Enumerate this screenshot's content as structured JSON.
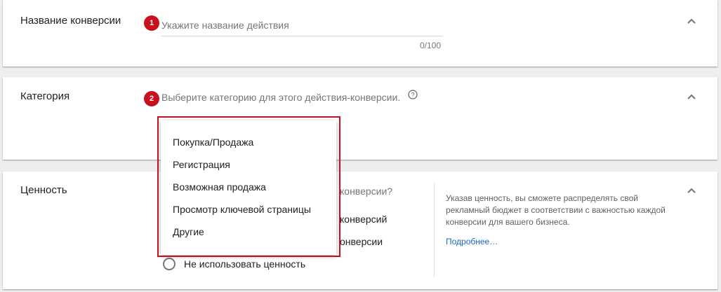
{
  "steps": {
    "one": "1",
    "two": "2"
  },
  "conversion_name": {
    "title": "Название конверсии",
    "placeholder": "Укажите название действия",
    "value": "",
    "counter": "0/100"
  },
  "category": {
    "title": "Категория",
    "placeholder": "Выберите категорию для этого действия-конверсии.",
    "options": [
      "Покупка/Продажа",
      "Регистрация",
      "Возможная продажа",
      "Просмотр ключевой страницы",
      "Другие"
    ]
  },
  "value": {
    "title": "Ценность",
    "question_tail": "конверсии?",
    "option1_tail": "конверсий",
    "option2_tail": "онверсии",
    "no_value_label": "Не использовать ценность",
    "info_text": "Указав ценность, вы сможете распределять свой рекламный бюджет в соответствии с важностью каждой конверсии для вашего бизнеса.",
    "more_link": "Подробнее…"
  },
  "icons": {
    "collapse": "chevron-up-icon",
    "help": "help-circle-icon"
  },
  "colors": {
    "badge": "#c9101d",
    "link": "#1a66c6",
    "highlight": "#c9101d"
  }
}
